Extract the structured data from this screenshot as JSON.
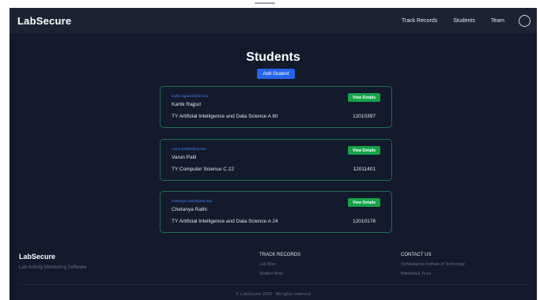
{
  "navbar": {
    "brand": "LabSecure",
    "links": [
      "Track Records",
      "Students",
      "Team"
    ]
  },
  "page": {
    "title": "Students",
    "add_button": "Add Student"
  },
  "students": [
    {
      "email": "kartik.rajput20@vit.edu",
      "name": "Kartik Rajput",
      "class": "TY Artificial Intelligence and Data Science A 60",
      "roll": "12010397",
      "button": "View Details"
    },
    {
      "email": "varun.patil20@vit.edu",
      "name": "Varun Patil",
      "class": "TY Computer Science C 22",
      "roll": "12011401",
      "button": "View Details"
    },
    {
      "email": "chetanya.rathi20@vit.edu",
      "name": "Chetanya Rathi",
      "class": "TY Artificial Intelligence and Data Science A 24",
      "roll": "12010178",
      "button": "View Details"
    }
  ],
  "footer": {
    "brand": "LabSecure",
    "tagline": "Lab Activity Monitoring Software",
    "track_heading": "TRACK RECORDS",
    "track_links": [
      "Lab Wise",
      "Student Wise"
    ],
    "contact_heading": "CONTACT US",
    "contact_lines": [
      "Vishwakarma Institute of Technology",
      "Bibwewadi, Pune"
    ],
    "copyright": "© LabSecure 2022 - All rights reserved"
  },
  "colors": {
    "background": "#121a2b",
    "navbar": "#1b2333",
    "primary_button": "#2563eb",
    "details_button": "#16a34a",
    "card_border": "#1f6f52",
    "email_link": "#3b82f6"
  }
}
